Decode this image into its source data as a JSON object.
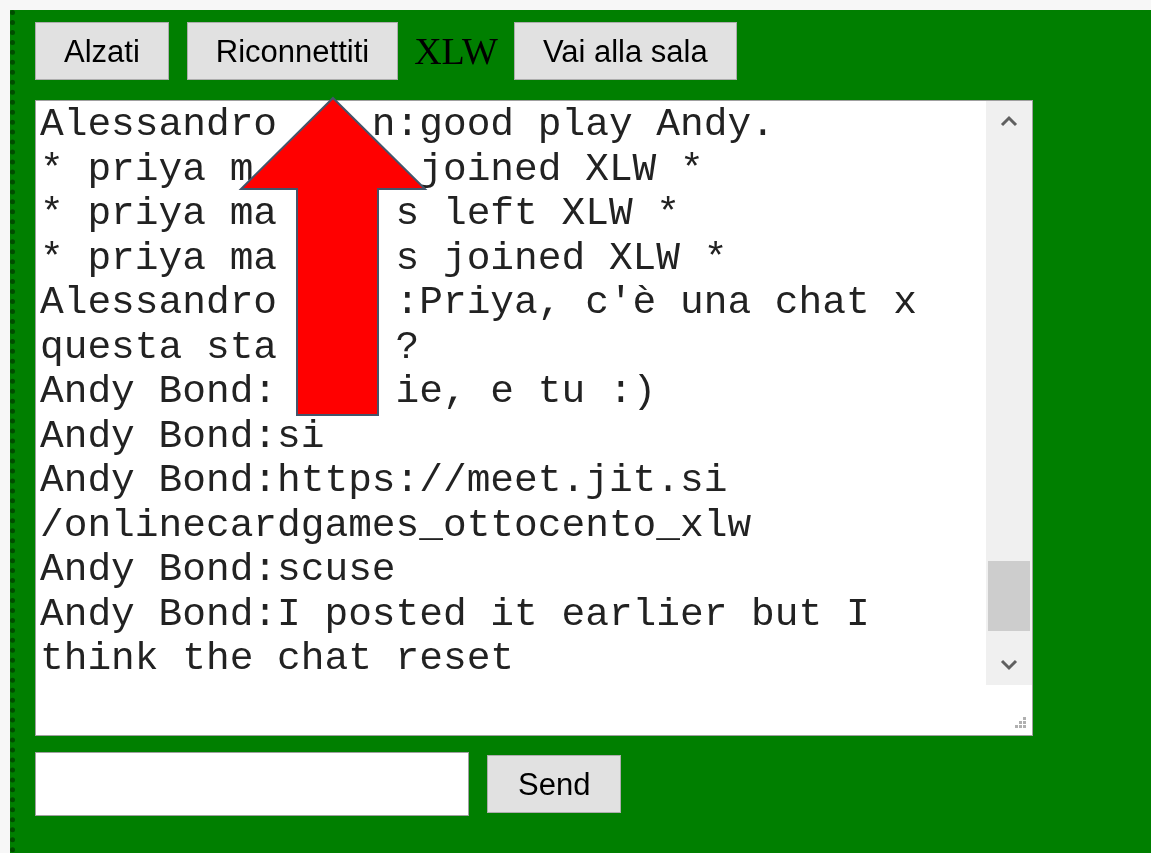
{
  "toolbar": {
    "buttons": [
      "Alzati",
      "Riconnettiti"
    ],
    "table_name": "XLW",
    "room_button": "Vai alla sala"
  },
  "chat": {
    "lines": [
      "Alessandro    n:good play Andy.",
      "* priya m       joined XLW *",
      "* priya ma     s left XLW *",
      "* priya ma     s joined XLW *",
      "Alessandro     :Priya, c'è una chat x",
      "questa sta     ?",
      "Andy Bond:     ie, e tu :)",
      "Andy Bond:si",
      "Andy Bond:https://meet.jit.si",
      "/onlinecardgames_ottocento_xlw",
      "Andy Bond:scuse",
      "Andy Bond:I posted it earlier but I",
      "think the chat reset"
    ]
  },
  "send_button": "Send"
}
